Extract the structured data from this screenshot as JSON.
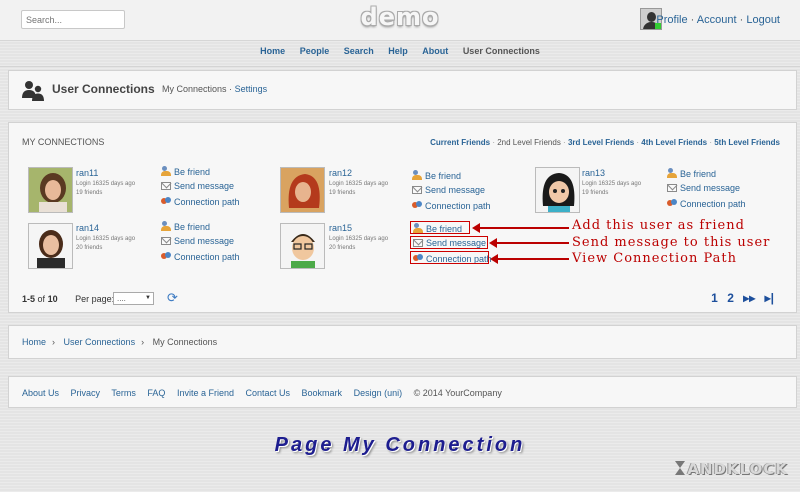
{
  "topbar": {
    "search_placeholder": "Search...",
    "logo": "demo",
    "profile": "Profile",
    "account": "Account",
    "logout": "Logout",
    "separator": "·"
  },
  "nav": [
    "Home",
    "People",
    "Search",
    "Help",
    "About",
    "User Connections"
  ],
  "header": {
    "title": "User Connections",
    "sub_current": "My Connections",
    "sub_sep": "·",
    "sub_settings": "Settings"
  },
  "connections": {
    "title": "MY CONNECTIONS",
    "filters": [
      "Current Friends",
      "2nd Level Friends",
      "3rd Level Friends",
      "4th Level Friends",
      "5th Level Friends"
    ],
    "users": [
      {
        "name": "ran11",
        "login": "Login 16325 days ago",
        "friends": "19 friends"
      },
      {
        "name": "ran12",
        "login": "Login 16325 days ago",
        "friends": "19 friends"
      },
      {
        "name": "ran13",
        "login": "Login 16325 days ago",
        "friends": "19 friends"
      },
      {
        "name": "ran14",
        "login": "Login 16325 days ago",
        "friends": "20 friends"
      },
      {
        "name": "ran15",
        "login": "Login 16325 days ago",
        "friends": "20 friends"
      }
    ],
    "actions": {
      "be_friend": "Be friend",
      "send_message": "Send message",
      "connection_path": "Connection path"
    },
    "annotations": [
      "Add this user as friend",
      "Send message to this user",
      "View Connection Path"
    ],
    "pager": {
      "range": "1-5",
      "of": "of",
      "total": "10",
      "per_page_label": "Per page:",
      "per_page_value": "....",
      "pages": [
        "1",
        "2"
      ],
      "current_page": "1"
    }
  },
  "breadcrumb": [
    "Home",
    "User Connections",
    "My Connections"
  ],
  "footer": {
    "links": [
      "About Us",
      "Privacy",
      "Terms",
      "FAQ",
      "Invite a Friend",
      "Contact Us",
      "Bookmark",
      "Design (uni)"
    ],
    "copyright": "© 2014 YourCompany"
  },
  "caption": "Page My Connection",
  "brand": "ANDKLOCK",
  "colors": {
    "link": "#2a6496",
    "annotation": "#bb0000",
    "caption": "#1d1d8f"
  }
}
